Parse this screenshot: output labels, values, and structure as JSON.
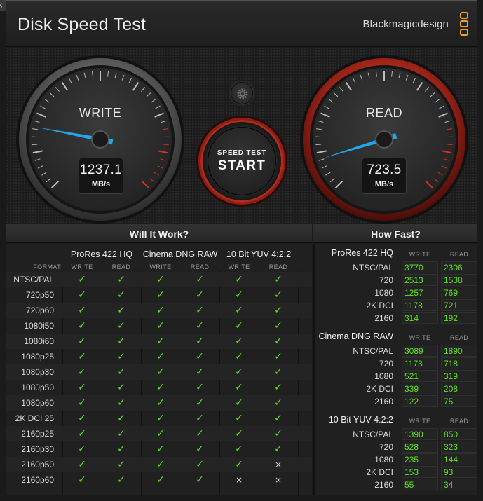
{
  "window": {
    "close": "×"
  },
  "header": {
    "title": "Disk Speed Test",
    "brand": "Blackmagicdesign"
  },
  "gauges": {
    "write": {
      "label": "WRITE",
      "value": "1237.1",
      "unit": "MB/s"
    },
    "read": {
      "label": "READ",
      "value": "723.5",
      "unit": "MB/s"
    }
  },
  "start_button": {
    "line1": "SPEED TEST",
    "line2": "START"
  },
  "will_it_work": {
    "title": "Will It Work?",
    "format_header": "FORMAT",
    "codecs": [
      "ProRes 422 HQ",
      "Cinema DNG RAW",
      "10 Bit YUV 4:2:2"
    ],
    "sub_headers": [
      "WRITE",
      "READ"
    ],
    "rows": [
      {
        "format": "NTSC/PAL",
        "results": [
          "✓",
          "✓",
          "✓",
          "✓",
          "✓",
          "✓"
        ]
      },
      {
        "format": "720p50",
        "results": [
          "✓",
          "✓",
          "✓",
          "✓",
          "✓",
          "✓"
        ]
      },
      {
        "format": "720p60",
        "results": [
          "✓",
          "✓",
          "✓",
          "✓",
          "✓",
          "✓"
        ]
      },
      {
        "format": "1080i50",
        "results": [
          "✓",
          "✓",
          "✓",
          "✓",
          "✓",
          "✓"
        ]
      },
      {
        "format": "1080i60",
        "results": [
          "✓",
          "✓",
          "✓",
          "✓",
          "✓",
          "✓"
        ]
      },
      {
        "format": "1080p25",
        "results": [
          "✓",
          "✓",
          "✓",
          "✓",
          "✓",
          "✓"
        ]
      },
      {
        "format": "1080p30",
        "results": [
          "✓",
          "✓",
          "✓",
          "✓",
          "✓",
          "✓"
        ]
      },
      {
        "format": "1080p50",
        "results": [
          "✓",
          "✓",
          "✓",
          "✓",
          "✓",
          "✓"
        ]
      },
      {
        "format": "1080p60",
        "results": [
          "✓",
          "✓",
          "✓",
          "✓",
          "✓",
          "✓"
        ]
      },
      {
        "format": "2K DCI 25",
        "results": [
          "✓",
          "✓",
          "✓",
          "✓",
          "✓",
          "✓"
        ]
      },
      {
        "format": "2160p25",
        "results": [
          "✓",
          "✓",
          "✓",
          "✓",
          "✓",
          "✓"
        ]
      },
      {
        "format": "2160p30",
        "results": [
          "✓",
          "✓",
          "✓",
          "✓",
          "✓",
          "✓"
        ]
      },
      {
        "format": "2160p50",
        "results": [
          "✓",
          "✓",
          "✓",
          "✓",
          "✓",
          "×"
        ]
      },
      {
        "format": "2160p60",
        "results": [
          "✓",
          "✓",
          "✓",
          "✓",
          "×",
          "×"
        ]
      }
    ]
  },
  "how_fast": {
    "title": "How Fast?",
    "sub_headers": [
      "WRITE",
      "READ"
    ],
    "groups": [
      {
        "codec": "ProRes 422 HQ",
        "rows": [
          {
            "format": "NTSC/PAL",
            "write": "3770",
            "read": "2306"
          },
          {
            "format": "720",
            "write": "2513",
            "read": "1538"
          },
          {
            "format": "1080",
            "write": "1257",
            "read": "769"
          },
          {
            "format": "2K DCI",
            "write": "1178",
            "read": "721"
          },
          {
            "format": "2160",
            "write": "314",
            "read": "192"
          }
        ]
      },
      {
        "codec": "Cinema DNG RAW",
        "rows": [
          {
            "format": "NTSC/PAL",
            "write": "3089",
            "read": "1890"
          },
          {
            "format": "720",
            "write": "1173",
            "read": "718"
          },
          {
            "format": "1080",
            "write": "521",
            "read": "319"
          },
          {
            "format": "2K DCI",
            "write": "339",
            "read": "208"
          },
          {
            "format": "2160",
            "write": "122",
            "read": "75"
          }
        ]
      },
      {
        "codec": "10 Bit YUV 4:2:2",
        "rows": [
          {
            "format": "NTSC/PAL",
            "write": "1390",
            "read": "850"
          },
          {
            "format": "720",
            "write": "528",
            "read": "323"
          },
          {
            "format": "1080",
            "write": "235",
            "read": "144"
          },
          {
            "format": "2K DCI",
            "write": "153",
            "read": "93"
          },
          {
            "format": "2160",
            "write": "55",
            "read": "34"
          }
        ]
      }
    ]
  },
  "colors": {
    "accent_red": "#d4321f",
    "needle_blue": "#1ea7f0",
    "ok_green": "#5fe020",
    "brand_orange": "#f0a030"
  }
}
